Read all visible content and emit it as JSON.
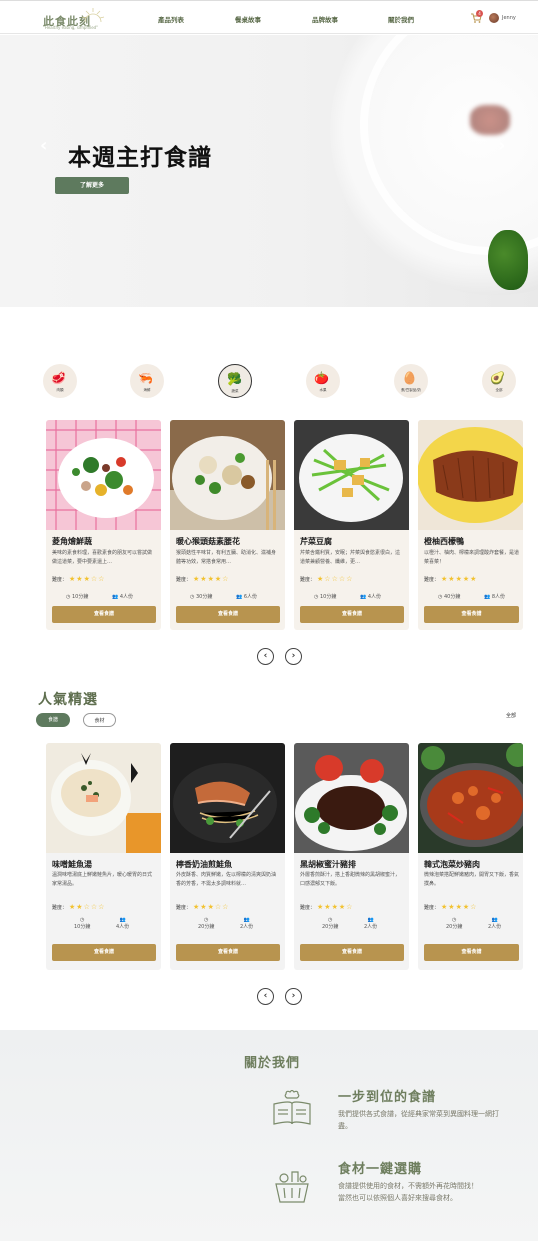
{
  "header": {
    "logo_text": "此食此刻",
    "logo_sub": "\"Healthy eating, simplified\"",
    "nav": [
      "產品列表",
      "餐桌故事",
      "品牌故事",
      "關於我們"
    ],
    "cart_count": "4",
    "user_name": "Jenny"
  },
  "hero": {
    "title": "本週主打食譜",
    "button": "了解更多",
    "prev_icon": "chevron-left-icon",
    "next_icon": "chevron-right-icon"
  },
  "categories": [
    {
      "label": "肉類",
      "icon": "meat-icon",
      "active": false
    },
    {
      "label": "海鮮",
      "icon": "shrimp-icon",
      "active": false
    },
    {
      "label": "蔬菜",
      "icon": "vegetables-icon",
      "active": true
    },
    {
      "label": "水果",
      "icon": "fruit-icon",
      "active": false
    },
    {
      "label": "蛋/豆製品/奶",
      "icon": "egg-icon",
      "active": false
    },
    {
      "label": "全部",
      "icon": "all-icon",
      "active": false
    }
  ],
  "weekly_recipes": [
    {
      "title": "菱角燴鮮蔬",
      "desc": "美味的素食料理，喜歡素食的朋友可以嘗試做做這道菜，要中要素還上…",
      "difficulty_label": "難度：",
      "stars": 3,
      "time": "10分鐘",
      "servings": "4人份",
      "button": "查看食譜"
    },
    {
      "title": "暖心猴頭菇素腰花",
      "desc": "猴頭菇性平味甘，有利五臟、助消化、滋補身體等功效，常搭食常用…",
      "difficulty_label": "難度：",
      "stars": 4,
      "time": "30分鐘",
      "servings": "6人份",
      "button": "查看食譜"
    },
    {
      "title": "芹菜豆腐",
      "desc": "芹菜含鐵利質，安眠；芹菜與食慾素很白，這道菜兼顧營養、纖維，更…",
      "difficulty_label": "難度：",
      "stars": 1,
      "time": "10分鐘",
      "servings": "4人份",
      "button": "查看食譜"
    },
    {
      "title": "橙柚西檬鴨",
      "desc": "以橙汁、柚肉、檸檬來調理酸炸套餐，是道菜喜菜！",
      "difficulty_label": "難度：",
      "stars": 5,
      "time": "40分鐘",
      "servings": "8人份",
      "button": "查看食譜"
    }
  ],
  "popular": {
    "title": "人氣精選",
    "tabs": [
      "食譜",
      "食材"
    ],
    "all_label": "全部",
    "items": [
      {
        "title": "味噌鮭魚湯",
        "desc": "溫潤味噌湯底上鮮嫩鮭魚片，暖心暖胃的日式家常湯品。",
        "difficulty_label": "難度：",
        "stars": 2,
        "time": "10分鐘",
        "servings": "4人份",
        "button": "查看食譜"
      },
      {
        "title": "檸香奶油煎鮭魚",
        "desc": "外皮酥香、肉質鮮嫩，佐以檸檬的清爽與奶油香的芳香，不需太多調味料就…",
        "difficulty_label": "難度：",
        "stars": 3,
        "time": "20分鐘",
        "servings": "2人份",
        "button": "查看食譜"
      },
      {
        "title": "黑胡椒蜜汁豬排",
        "desc": "外層香煎酥汁，搭上香甜微辣的黑胡椒蜜汁，口感濃郁又下飯。",
        "difficulty_label": "難度：",
        "stars": 4,
        "time": "20分鐘",
        "servings": "2人份",
        "button": "查看食譜"
      },
      {
        "title": "韓式泡菜炒豬肉",
        "desc": "微辣泡菜搭配鮮嫩豬肉，開胃又下飯，香氣撲鼻。",
        "difficulty_label": "難度：",
        "stars": 4,
        "time": "20分鐘",
        "servings": "2人份",
        "button": "查看食譜"
      }
    ]
  },
  "about": {
    "title": "關於我們",
    "features": [
      {
        "title": "一步到位的食譜",
        "desc": "我們提供各式食譜，從經典家常菜到異國料理一網打盡。",
        "icon": "recipe-book-icon"
      },
      {
        "title": "食材一鍵選購",
        "desc": "食譜提供使用的食材，不需額外再花時間找！",
        "desc2": "當然也可以依照個人喜好來搜尋食材。",
        "icon": "grocery-basket-icon"
      }
    ]
  },
  "colors": {
    "brand_green": "#5e7a5e",
    "button_gold": "#b8944f",
    "star": "#f2c230",
    "badge_red": "#d9534f"
  }
}
